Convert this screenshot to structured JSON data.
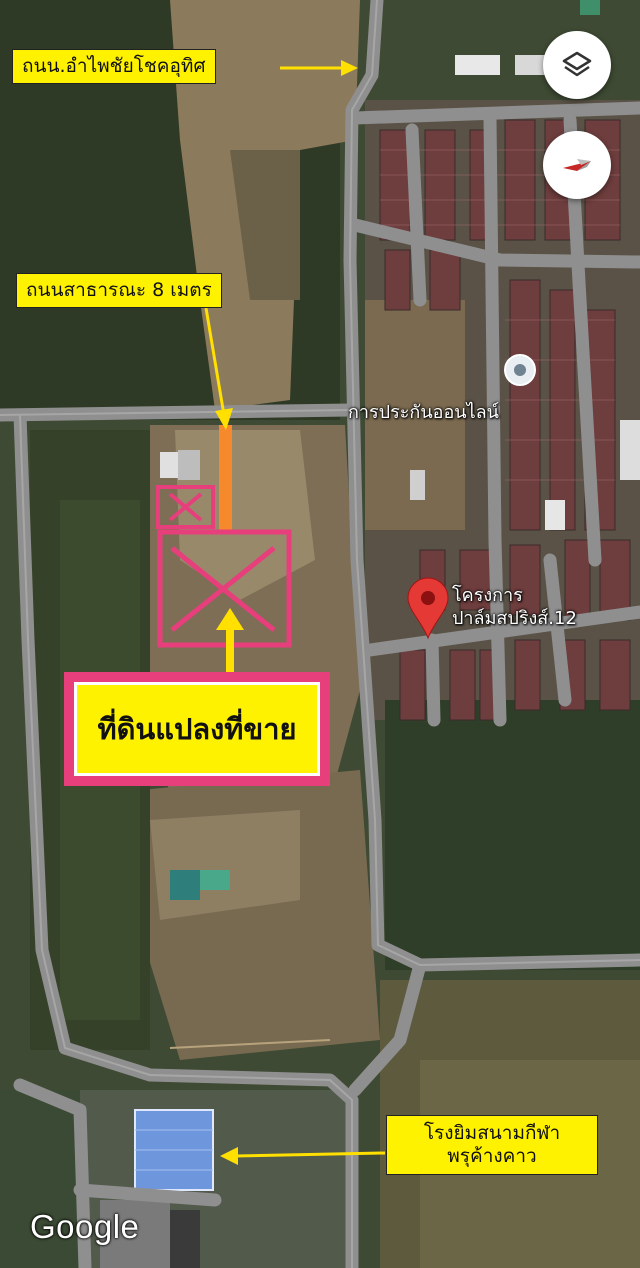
{
  "map": {
    "provider": "Google",
    "view": "satellite"
  },
  "labels": {
    "road_main": "ถนน.อำไพชัยโชคอุทิศ",
    "road_public": "ถนนสาธารณะ 8 เมตร",
    "land_for_sale": "ที่ดินแปลงที่ขาย",
    "gym_line1": "โรงยิมสนามกีฬา",
    "gym_line2": "พรุค้างคาว"
  },
  "places": {
    "insurance": "การประกันออนไลน์",
    "project_line1": "โครงการ",
    "project_line2": "ปาล์มสปริงส์.12"
  },
  "controls": {
    "layers_icon": "layers-icon",
    "compass_icon": "compass-icon"
  },
  "colors": {
    "label_bg": "#fff200",
    "marker_pink": "#e63f7c",
    "public_road": "#f5892b",
    "arrow": "#ffe000",
    "pin": "#e53935"
  }
}
